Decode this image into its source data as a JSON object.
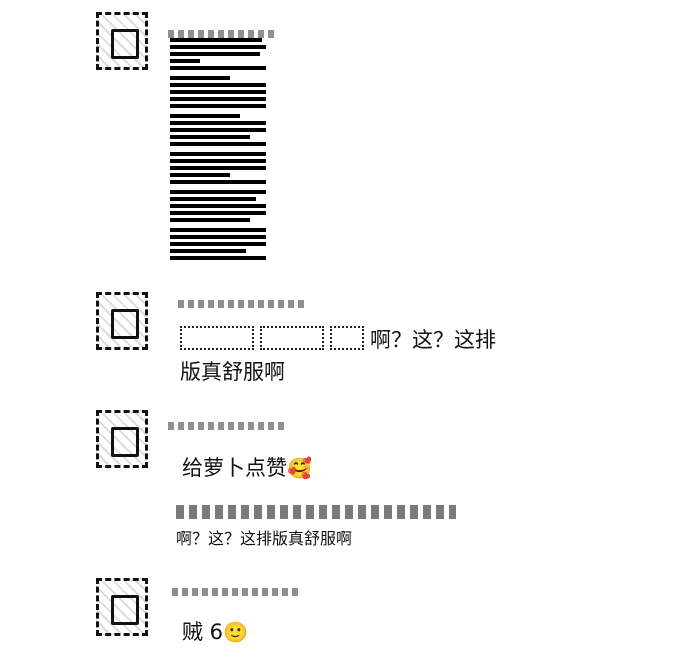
{
  "comments": [
    {
      "text": ""
    },
    {
      "text": "啊？这？这排\n版真舒服啊"
    },
    {
      "text": "给萝卜点赞",
      "emoji": "🥰"
    },
    {
      "text": "贼 6",
      "emoji": "🙂"
    }
  ],
  "reply": {
    "text": "啊？这？这排版真舒服啊"
  }
}
